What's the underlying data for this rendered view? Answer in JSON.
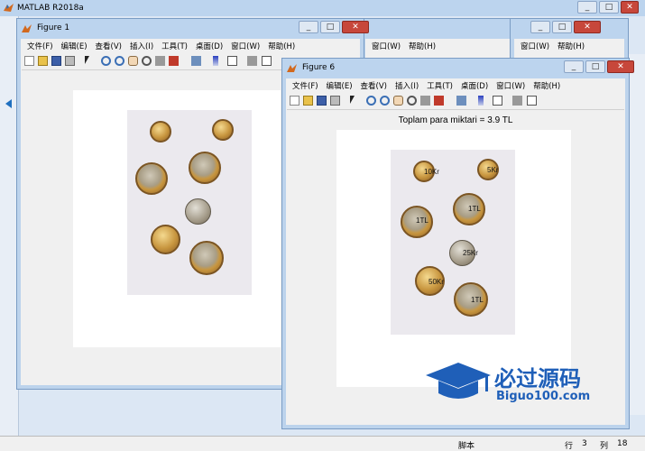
{
  "matlab": {
    "title": "MATLAB R2018a"
  },
  "bg_window": {
    "menus": [
      "窗口(W)",
      "帮助(H)"
    ]
  },
  "figure1": {
    "title": "Figure 1",
    "menus": [
      "文件(F)",
      "编辑(E)",
      "查看(V)",
      "插入(I)",
      "工具(T)",
      "桌面(D)",
      "窗口(W)",
      "帮助(H)"
    ]
  },
  "figure6": {
    "title": "Figure 6",
    "menus": [
      "文件(F)",
      "编辑(E)",
      "查看(V)",
      "插入(I)",
      "工具(T)",
      "桌面(D)",
      "窗口(W)",
      "帮助(H)"
    ],
    "plot_title": "Toplam para miktari = 3.9 TL",
    "coin_labels": [
      "10Kr",
      "5Kr",
      "1TL",
      "1TL",
      "25Kr",
      "50Kr",
      "1TL"
    ]
  },
  "status": {
    "script_label": "脚本",
    "row_label": "行",
    "row": "3",
    "col_label": "列",
    "col": "18"
  },
  "watermark": {
    "brand": "必过源码",
    "url": "Biguo100.com"
  },
  "colors": {
    "titlebar": "#bcd4ee",
    "accent_blue": "#1f5fb8",
    "close_red": "#c7473b"
  }
}
